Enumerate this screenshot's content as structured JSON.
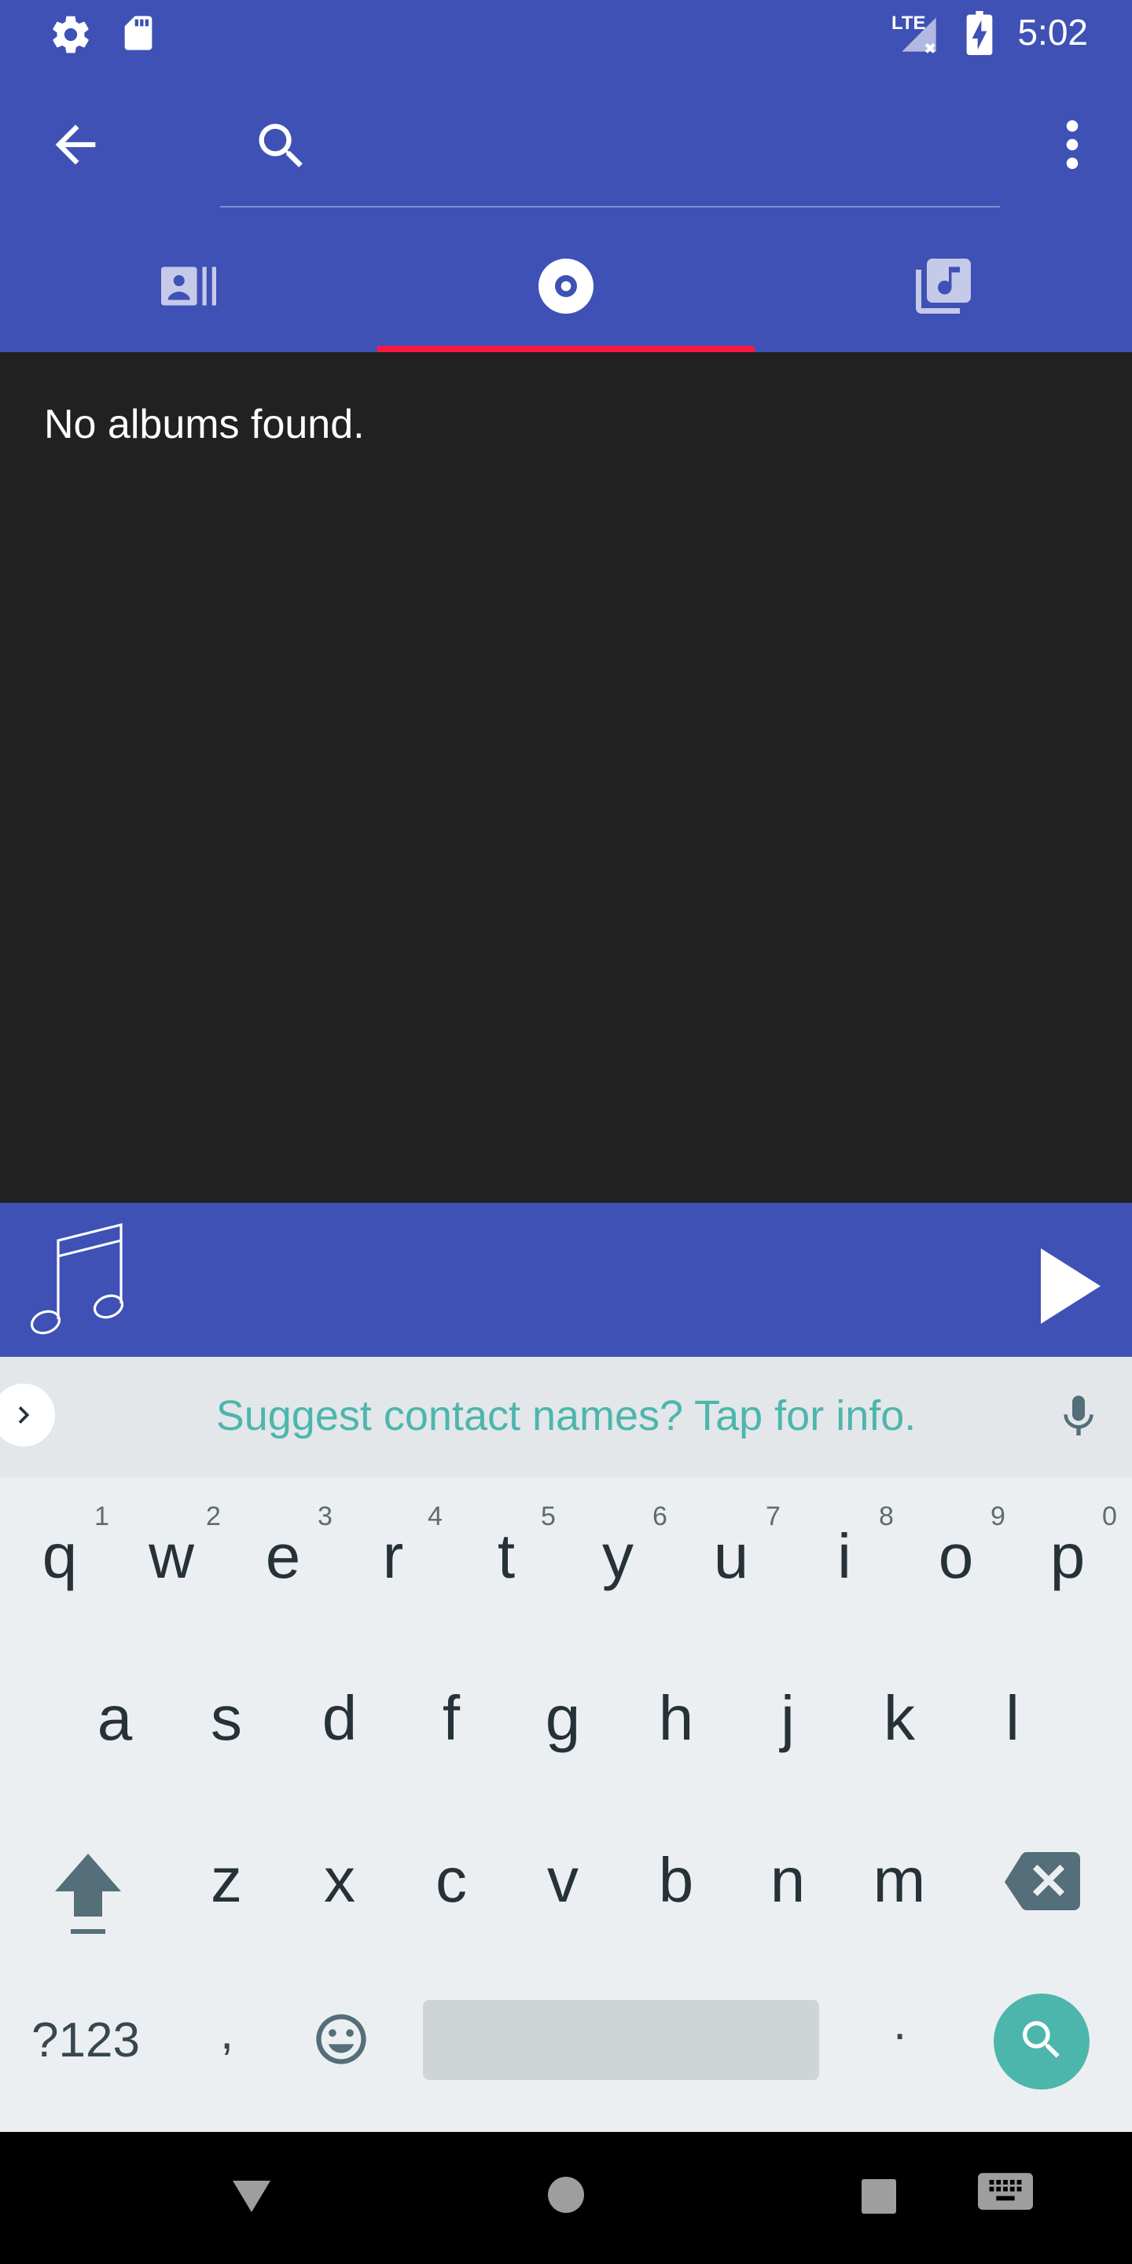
{
  "status_bar": {
    "time": "5:02",
    "network": "LTE",
    "icons": [
      "gear-icon",
      "sd-card-icon",
      "signal-icon",
      "battery-charging-icon"
    ]
  },
  "app_bar": {
    "search_placeholder": "",
    "tabs": [
      {
        "icon": "artists-icon",
        "selected": false
      },
      {
        "icon": "album-icon",
        "selected": true
      },
      {
        "icon": "songs-icon",
        "selected": false
      }
    ],
    "accent_color": "#3F51B5",
    "indicator_color": "#FF1744"
  },
  "content": {
    "empty_message": "No albums found."
  },
  "now_playing": {
    "art_icon": "music-note-icon",
    "play_icon": "play-icon"
  },
  "keyboard": {
    "suggestion": "Suggest contact names? Tap for info.",
    "row1": [
      {
        "k": "q",
        "h": "1"
      },
      {
        "k": "w",
        "h": "2"
      },
      {
        "k": "e",
        "h": "3"
      },
      {
        "k": "r",
        "h": "4"
      },
      {
        "k": "t",
        "h": "5"
      },
      {
        "k": "y",
        "h": "6"
      },
      {
        "k": "u",
        "h": "7"
      },
      {
        "k": "i",
        "h": "8"
      },
      {
        "k": "o",
        "h": "9"
      },
      {
        "k": "p",
        "h": "0"
      }
    ],
    "row2": [
      "a",
      "s",
      "d",
      "f",
      "g",
      "h",
      "j",
      "k",
      "l"
    ],
    "row3": [
      "z",
      "x",
      "c",
      "v",
      "b",
      "n",
      "m"
    ],
    "symbols_key": "?123",
    "comma_key": ",",
    "period_key": "."
  }
}
